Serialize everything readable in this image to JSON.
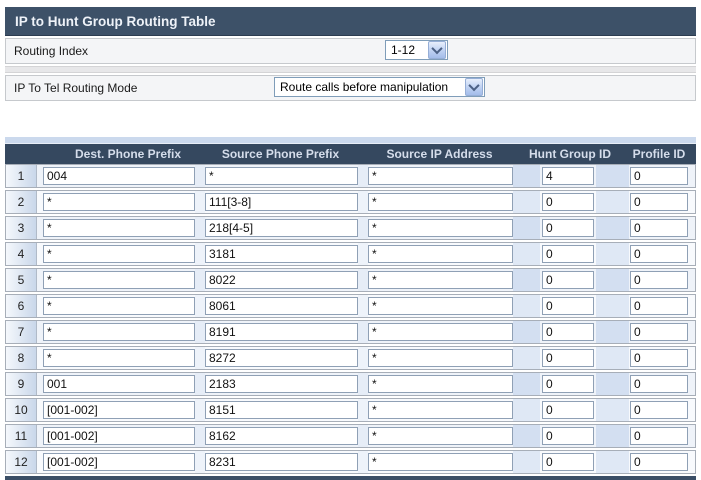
{
  "title": "IP to Hunt Group Routing Table",
  "controls": {
    "routing_index": {
      "label": "Routing Index",
      "value": "1-12"
    },
    "routing_mode": {
      "label": "IP To Tel Routing Mode",
      "value": "Route calls before manipulation"
    }
  },
  "table": {
    "headers": [
      "Dest. Phone Prefix",
      "Source Phone Prefix",
      "Source IP Address",
      "Hunt Group ID",
      "Profile ID"
    ],
    "rows": [
      {
        "index": "1",
        "dest": "004",
        "src": "*",
        "ip": "*",
        "hunt": "4",
        "profile": "0"
      },
      {
        "index": "2",
        "dest": "*",
        "src": "111[3-8]",
        "ip": "*",
        "hunt": "0",
        "profile": "0"
      },
      {
        "index": "3",
        "dest": "*",
        "src": "218[4-5]",
        "ip": "*",
        "hunt": "0",
        "profile": "0"
      },
      {
        "index": "4",
        "dest": "*",
        "src": "3181",
        "ip": "*",
        "hunt": "0",
        "profile": "0"
      },
      {
        "index": "5",
        "dest": "*",
        "src": "8022",
        "ip": "*",
        "hunt": "0",
        "profile": "0"
      },
      {
        "index": "6",
        "dest": "*",
        "src": "8061",
        "ip": "*",
        "hunt": "0",
        "profile": "0"
      },
      {
        "index": "7",
        "dest": "*",
        "src": "8191",
        "ip": "*",
        "hunt": "0",
        "profile": "0"
      },
      {
        "index": "8",
        "dest": "*",
        "src": "8272",
        "ip": "*",
        "hunt": "0",
        "profile": "0"
      },
      {
        "index": "9",
        "dest": "001",
        "src": "2183",
        "ip": "*",
        "hunt": "0",
        "profile": "0"
      },
      {
        "index": "10",
        "dest": "[001-002]",
        "src": "8151",
        "ip": "*",
        "hunt": "0",
        "profile": "0"
      },
      {
        "index": "11",
        "dest": "[001-002]",
        "src": "8162",
        "ip": "*",
        "hunt": "0",
        "profile": "0"
      },
      {
        "index": "12",
        "dest": "[001-002]",
        "src": "8231",
        "ip": "*",
        "hunt": "0",
        "profile": "0"
      }
    ]
  },
  "icons": {
    "select_arrow": "chevron-down"
  },
  "colors": {
    "title_bg": "#3d5168",
    "table_header_bg": "#35485f",
    "table_header_text": "#d5ddeb",
    "strip_blue": "#d3dff1",
    "select_border": "#7f9db9"
  }
}
